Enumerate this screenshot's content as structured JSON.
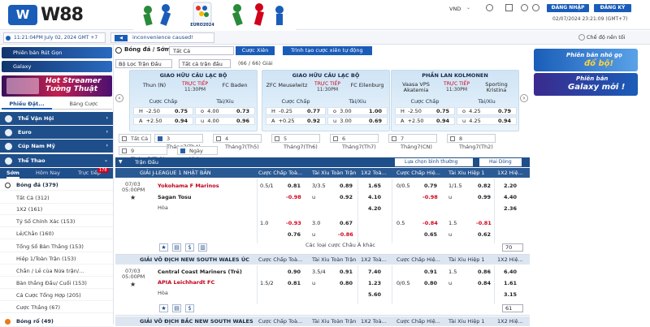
{
  "brand": {
    "logo_letters": "W",
    "name": "W88",
    "banner_text": "EURO2024"
  },
  "header": {
    "currency": "VND",
    "login": "ĐĂNG NHẬP",
    "register": "ĐĂNG KÝ",
    "datetime": "02/07/2024 23:21:09 (GMT+7)"
  },
  "infobar": {
    "time": "11:21:04PM July 02, 2024 GMT +7",
    "news": "inconvenience caused!",
    "dark_mode": "Chế độ nền tối"
  },
  "sidebar": {
    "banner1": "Phiên bản Rút Gọn",
    "banner2": "Galaxy",
    "hot_streamer": "Hot Streamer Tường Thuật",
    "tab1": "Phiếu Đặt...",
    "tab2": "Bảng Cược",
    "cats": [
      "Thể Vận Hội",
      "Euro",
      "Cúp Nam Mỹ",
      "Thể Thao"
    ],
    "subtabs": [
      "Sớm",
      "Hôm Nay",
      "Trực tiếp"
    ],
    "live_count": "178",
    "sport_root": "Bóng đá (379)",
    "items": [
      "Tất Cả (312)",
      "1X2 (161)",
      "Tỷ Số Chính Xác (153)",
      "Lẻ/Chẵn (160)",
      "Tổng Số Bàn Thắng (153)",
      "Hiệp 1/Toàn Trận (153)",
      "Chẵn / Lẻ của Nửa trận/...",
      "Bàn thắng Đầu/ Cuối (153)",
      "Cá Cược Tổng Hợp (205)",
      "Cược Thắng (67)"
    ],
    "basketball": "Bóng rổ (49)"
  },
  "toolbar": {
    "sport": "Bóng đá / Sớm",
    "all": "Tất Cả",
    "parlay": "Cược Xiên",
    "create_parlay": "Trình tạo cược xiên tự động",
    "filter_league": "Bộ Lọc Trận Đấu",
    "filter_all": "Tất cả trận đấu",
    "count": "(66 / 66) Giải"
  },
  "featured": [
    {
      "league": "GIAO HỮU CÂU LẠC BỘ",
      "home": "Thun (N)",
      "away": "FC Baden",
      "live": "TRỰC TIẾP",
      "time": "11:30PM",
      "ah": [
        [
          "H",
          "-2.50",
          "0.75"
        ],
        [
          "A",
          "+2.50",
          "0.94"
        ]
      ],
      "ou": [
        [
          "o",
          "4.00",
          "0.73"
        ],
        [
          "u",
          "4.00",
          "0.96"
        ]
      ]
    },
    {
      "league": "GIAO HỮU CÂU LẠC BỘ",
      "home": "ZFC Meuselwitz",
      "away": "FC Eilenburg",
      "live": "TRỰC TIẾP",
      "time": "11:30PM",
      "ah": [
        [
          "H",
          "-0.25",
          "0.77"
        ],
        [
          "A",
          "+0.25",
          "0.92"
        ]
      ],
      "ou": [
        [
          "o",
          "3.00",
          "1.00"
        ],
        [
          "u",
          "3.00",
          "0.69"
        ]
      ]
    },
    {
      "league": "PHẦN LAN KOLMONEN",
      "home": "Vaasa VPS Akatemia",
      "away": "Sporting Kristina",
      "live": "TRỰC TIẾP",
      "time": "11:30PM",
      "ah": [
        [
          "H",
          "-2.50",
          "0.75"
        ],
        [
          "A",
          "+2.50",
          "0.94"
        ]
      ],
      "ou": [
        [
          "o",
          "4.25",
          "0.79"
        ],
        [
          "u",
          "4.25",
          "0.94"
        ]
      ]
    }
  ],
  "featured_labels": {
    "ah": "Cược Chấp",
    "ou": "Tài/Xỉu"
  },
  "dates": [
    "Tất Cả",
    "3 Tháng7(Th4)",
    "4 Tháng7(Th5)",
    "5 Tháng7(Th6)",
    "6 Tháng7(Th7)",
    "7 Tháng7(CN)",
    "8 Tháng7(Th2)",
    "9 Tháng7(Th3)",
    "Ngày khác"
  ],
  "table": {
    "title": "Trận Đấu",
    "sort": "Lựa chọn bình thường",
    "order": "Hai Dòng",
    "cols": [
      "Thời Gian",
      "Trận Đấu",
      "Cược Chấp Toà...",
      "Tài Xỉu Toàn Trận",
      "1X2 Toà...",
      "Cược Chấp Hiệ...",
      "Tài Xỉu Hiệp 1",
      "1X2 Hiệ..."
    ],
    "more_ah": "Các loại cược Châu Á khác"
  },
  "leagues": [
    {
      "name": "GIẢI J-LEAGUE 1 NHẬT BẢN",
      "date": "07/03",
      "time": "05:00PM",
      "home": "Yokohama F Marinos",
      "away": "Sagan Tosu",
      "draw": "Hòa",
      "more": "70",
      "r1": [
        "0.5/1",
        "0.81",
        "3/3.5",
        "0.89",
        "1.65",
        "0/0.5",
        "0.79",
        "1/1.5",
        "0.82",
        "2.20"
      ],
      "r2": [
        "",
        "-0.98",
        "u",
        "0.92",
        "4.10",
        "",
        "-0.98",
        "u",
        "0.99",
        "4.40"
      ],
      "r3": [
        "",
        "",
        "",
        "",
        "4.20",
        "",
        "",
        "",
        "",
        "2.36"
      ],
      "r4": [
        "1.0",
        "-0.93",
        "3.0",
        "0.67",
        "",
        "0.5",
        "-0.84",
        "1.5",
        "-0.81",
        ""
      ],
      "r5": [
        "",
        "0.76",
        "u",
        "-0.86",
        "",
        "",
        "0.65",
        "u",
        "0.62",
        ""
      ]
    },
    {
      "name": "GIẢI VÔ ĐỊCH NEW SOUTH WALES ÚC",
      "date": "07/03",
      "time": "05:00PM",
      "home": "Central Coast Mariners (Trẻ)",
      "away": "APIA Leichhardt FC",
      "draw": "Hòa",
      "more": "61",
      "r1": [
        "",
        "0.90",
        "3.5/4",
        "0.91",
        "7.40",
        "",
        "0.91",
        "1.5",
        "0.86",
        "6.40"
      ],
      "r2": [
        "1.5/2",
        "0.81",
        "u",
        "0.80",
        "1.23",
        "0/0.5",
        "0.80",
        "u",
        "0.84",
        "1.61"
      ],
      "r3": [
        "",
        "",
        "",
        "",
        "5.60",
        "",
        "",
        "",
        "",
        "3.15"
      ]
    },
    {
      "name": "GIẢI VÔ ĐỊCH BẮC NEW SOUTH WALES"
    }
  ],
  "promos": [
    {
      "l1": "Phiên bản nhỏ gọ",
      "l2": "đổ bộ!"
    },
    {
      "l1": "Phiên bản",
      "l2": "Galaxy mới !"
    }
  ]
}
